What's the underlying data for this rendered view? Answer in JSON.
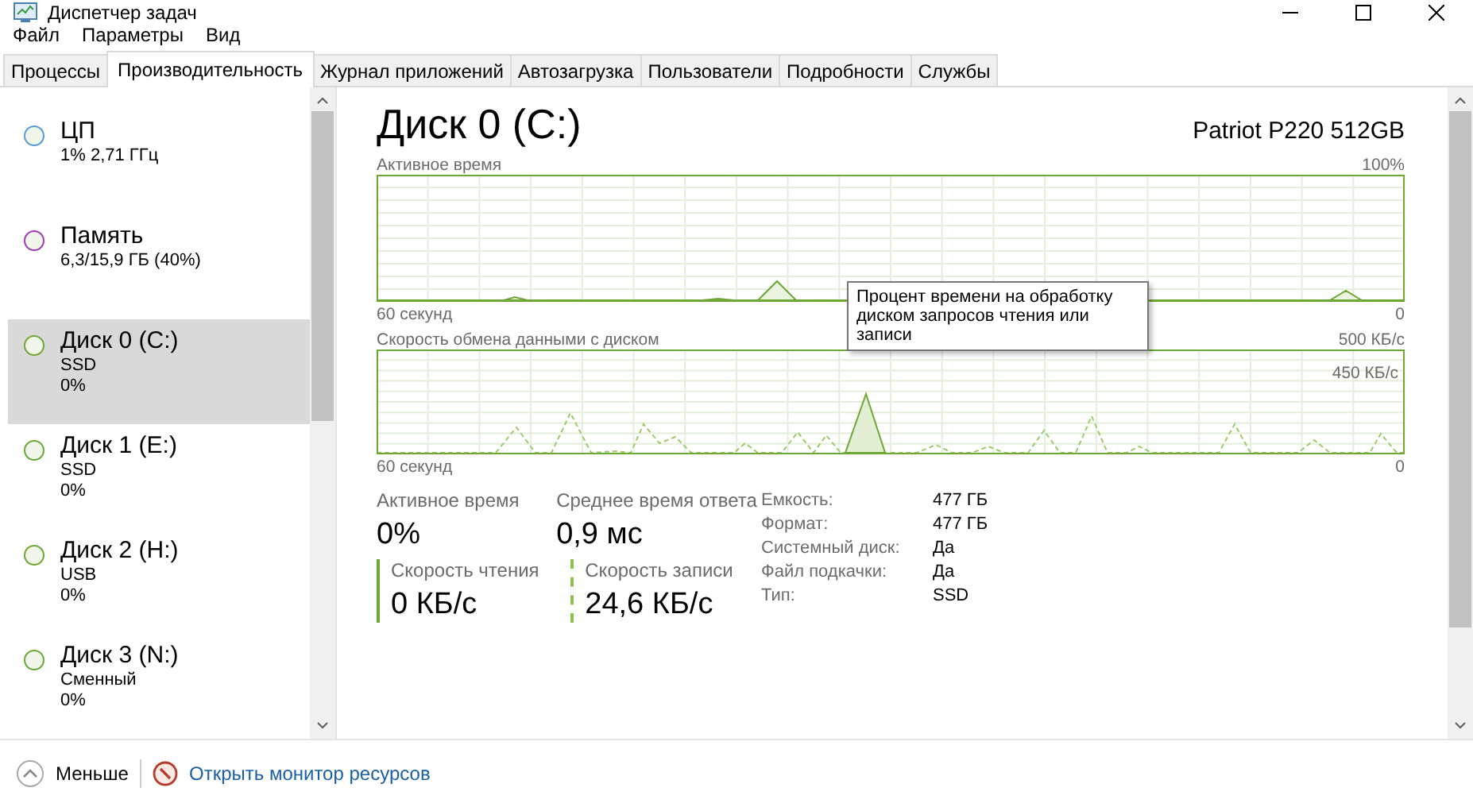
{
  "window": {
    "title": "Диспетчер задач"
  },
  "menu": [
    "Файл",
    "Параметры",
    "Вид"
  ],
  "tabs": [
    {
      "label": "Процессы",
      "selected": false
    },
    {
      "label": "Производительность",
      "selected": true
    },
    {
      "label": "Журнал приложений",
      "selected": false
    },
    {
      "label": "Автозагрузка",
      "selected": false
    },
    {
      "label": "Пользователи",
      "selected": false
    },
    {
      "label": "Подробности",
      "selected": false
    },
    {
      "label": "Службы",
      "selected": false
    }
  ],
  "sidebar": {
    "items": [
      {
        "name": "ЦП",
        "lines": [
          "1% 2,71 ГГц"
        ],
        "color": "#5b9bd5",
        "selected": false
      },
      {
        "name": "Память",
        "lines": [
          "6,3/15,9 ГБ (40%)"
        ],
        "color": "#a03cb4",
        "selected": false
      },
      {
        "name": "Диск 0 (C:)",
        "lines": [
          "SSD",
          "0%"
        ],
        "color": "#6ea834",
        "selected": true
      },
      {
        "name": "Диск 1 (E:)",
        "lines": [
          "SSD",
          "0%"
        ],
        "color": "#6ea834",
        "selected": false
      },
      {
        "name": "Диск 2 (H:)",
        "lines": [
          "USB",
          "0%"
        ],
        "color": "#6ea834",
        "selected": false
      },
      {
        "name": "Диск 3 (N:)",
        "lines": [
          "Сменный",
          "0%"
        ],
        "color": "#6ea834",
        "selected": false
      }
    ]
  },
  "detail": {
    "title": "Диск 0 (C:)",
    "model": "Patriot P220 512GB",
    "graphs": [
      {
        "kind": "active",
        "label": "Активное время",
        "max": "100%",
        "time": "60 секунд",
        "min": "0"
      },
      {
        "kind": "transfer",
        "label": "Скорость обмена данными с диском",
        "max": "500 КБ/с",
        "scale_mark": "450 КБ/с",
        "time": "60 секунд",
        "min": "0"
      }
    ],
    "stats": [
      {
        "label": "Активное время",
        "value": "0%"
      },
      {
        "label": "Среднее время ответа",
        "value": "0,9 мс"
      }
    ],
    "rates": [
      {
        "label": "Скорость чтения",
        "value": "0 КБ/с",
        "kind": "solid"
      },
      {
        "label": "Скорость записи",
        "value": "24,6 КБ/с",
        "kind": "dashed"
      }
    ],
    "properties": [
      {
        "label": "Емкость:",
        "value": "477 ГБ"
      },
      {
        "label": "Формат:",
        "value": "477 ГБ"
      },
      {
        "label": "Системный диск:",
        "value": "Да"
      },
      {
        "label": "Файл подкачки:",
        "value": "Да"
      },
      {
        "label": "Тип:",
        "value": "SSD"
      }
    ]
  },
  "tooltip": "Процент времени на обработку диском запросов чтения или записи",
  "footer": {
    "less": "Меньше",
    "monitor_link": "Открыть монитор ресурсов"
  }
}
